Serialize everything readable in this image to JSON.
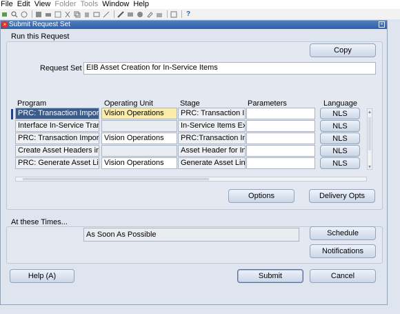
{
  "menu": {
    "items": [
      {
        "label": "File",
        "enabled": true
      },
      {
        "label": "Edit",
        "enabled": true
      },
      {
        "label": "View",
        "enabled": true
      },
      {
        "label": "Folder",
        "enabled": false
      },
      {
        "label": "Tools",
        "enabled": false
      },
      {
        "label": "Window",
        "enabled": true
      },
      {
        "label": "Help",
        "enabled": true
      }
    ]
  },
  "toolbar": {
    "icons": [
      "new-icon",
      "find-icon",
      "navigator-icon",
      "save-icon",
      "print-icon",
      "close-form-icon",
      "cut-icon",
      "copy-icon",
      "paste-icon",
      "clear-record-icon",
      "delete-icon",
      "edit-field-icon",
      "zoom-icon",
      "translations-icon",
      "attachments-icon",
      "folder-tools-icon",
      "help-icon"
    ]
  },
  "window": {
    "title": "Submit Request Set"
  },
  "run_section": {
    "heading": "Run this Request",
    "copy_button": "Copy",
    "request_set_label": "Request Set",
    "request_set_value": "EIB Asset Creation for In-Service Items"
  },
  "table": {
    "headers": {
      "program": "Program",
      "operating_unit": "Operating Unit",
      "stage": "Stage",
      "parameters": "Parameters",
      "language": "Language"
    },
    "rows": [
      {
        "program": "PRC: Transaction Import",
        "operating_unit": "Vision Operations",
        "stage": "PRC: Transaction Im",
        "parameters": "",
        "language": "NLS"
      },
      {
        "program": "Interface In-Service Trans",
        "operating_unit": "",
        "stage": "In-Service Items Ex",
        "parameters": "",
        "language": "NLS"
      },
      {
        "program": "PRC: Transaction Import",
        "operating_unit": "Vision Operations",
        "stage": "PRC:Transaction Im",
        "parameters": "",
        "language": "NLS"
      },
      {
        "program": "Create Asset Headers in C",
        "operating_unit": "",
        "stage": "Asset Header for In",
        "parameters": "",
        "language": "NLS"
      },
      {
        "program": "PRC: Generate Asset Line",
        "operating_unit": "Vision Operations",
        "stage": "Generate Asset Line",
        "parameters": "",
        "language": "NLS"
      }
    ],
    "options_button": "Options",
    "delivery_button": "Delivery Opts"
  },
  "times_section": {
    "heading": "At these Times...",
    "schedule_value": "As Soon As Possible",
    "schedule_button": "Schedule",
    "notifications_button": "Notifications"
  },
  "footer": {
    "help_button": "Help (A)",
    "submit_button": "Submit",
    "cancel_button": "Cancel"
  },
  "colors": {
    "title_bar": "#2f5fa8",
    "selected_cell": "#3c5c8c",
    "highlight_cell": "#fcecaa",
    "background": "#dfe5ee"
  }
}
